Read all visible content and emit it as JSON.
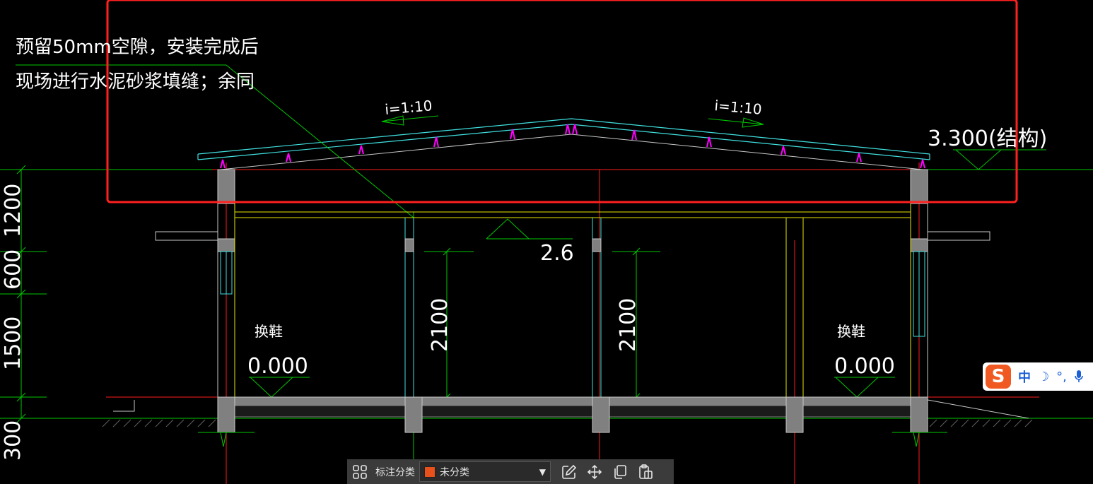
{
  "annotation": {
    "line1": "预留50mm空隙，安装完成后",
    "line2": "现场进行水泥砂浆填缝；余同"
  },
  "slope_left": "i=1:10",
  "slope_right": "i=1:10",
  "roof_level": "3.300(结构)",
  "beam_level": "2.6",
  "room_left": "换鞋",
  "room_right": "换鞋",
  "floor_left": "0.000",
  "floor_right": "0.000",
  "dims_vertical": [
    "1200",
    "600",
    "1500",
    "300"
  ],
  "door_height_left": "2100",
  "door_height_right": "2100",
  "ime": {
    "logo": "S",
    "lang": "中",
    "moon": "☽",
    "punct": "°,",
    "mic": "mic-icon"
  },
  "toolbar": {
    "label": "标注分类",
    "selected": "未分类",
    "icons": [
      "grid-icon",
      "edit-icon",
      "move-icon",
      "copy-icon",
      "paste-icon"
    ]
  },
  "colors": {
    "background": "#000000",
    "selection": "#ff2020",
    "green": "#00c800",
    "cyan": "#40e0e0",
    "magenta": "#ff00ff",
    "yellow": "#e6e600",
    "red": "#ff0000",
    "gray": "#808080"
  }
}
